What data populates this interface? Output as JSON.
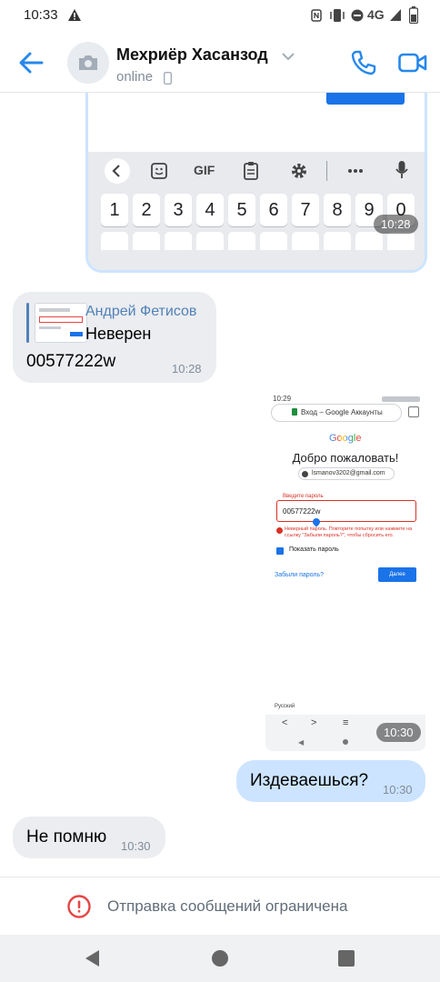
{
  "status_bar": {
    "time": "10:33",
    "network": "4G"
  },
  "header": {
    "contact_name": "Мехриёр Хасанзод",
    "contact_status": "online",
    "icons": [
      "back-arrow-icon",
      "camera-icon",
      "chevron-down-icon",
      "phone-icon",
      "video-call-icon"
    ]
  },
  "messages": {
    "photo1": {
      "time": "10:28",
      "keyboard_toolbar": {
        "gif_label": "GIF"
      },
      "number_row": [
        "1",
        "2",
        "3",
        "4",
        "5",
        "6",
        "7",
        "8",
        "9",
        "0"
      ]
    },
    "reply_message": {
      "quoted_author": "Андрей Фетисов",
      "quoted_text": "Неверен",
      "text": "00577222w",
      "time": "10:28"
    },
    "photo2": {
      "time": "10:30",
      "screenshot": {
        "status_time": "10:29",
        "url_text": "Вход – Google Аккаунты",
        "logo": "Google",
        "welcome": "Добро пожаловать!",
        "email": "lsmanov3202@gmail.com",
        "password_label": "Введите пароль",
        "password_value": "00577222w",
        "error_text": "Неверный пароль. Повторите попытку или нажмите на ссылку \"Забыли пароль?\", чтобы сбросить его.",
        "show_password": "Показать пароль",
        "forgot_password": "Забыли пароль?",
        "next_button": "Далее",
        "language": "Русский"
      }
    },
    "outgoing": {
      "text": "Издеваешься?",
      "time": "10:30"
    },
    "incoming_last": {
      "text": "Не помню",
      "time": "10:30"
    }
  },
  "footer": {
    "restricted_text": "Отправка сообщений ограничена"
  },
  "colors": {
    "accent": "#2688eb",
    "bubble_in": "#ebedf0",
    "bubble_out": "#cce4ff",
    "error": "#e64646"
  }
}
